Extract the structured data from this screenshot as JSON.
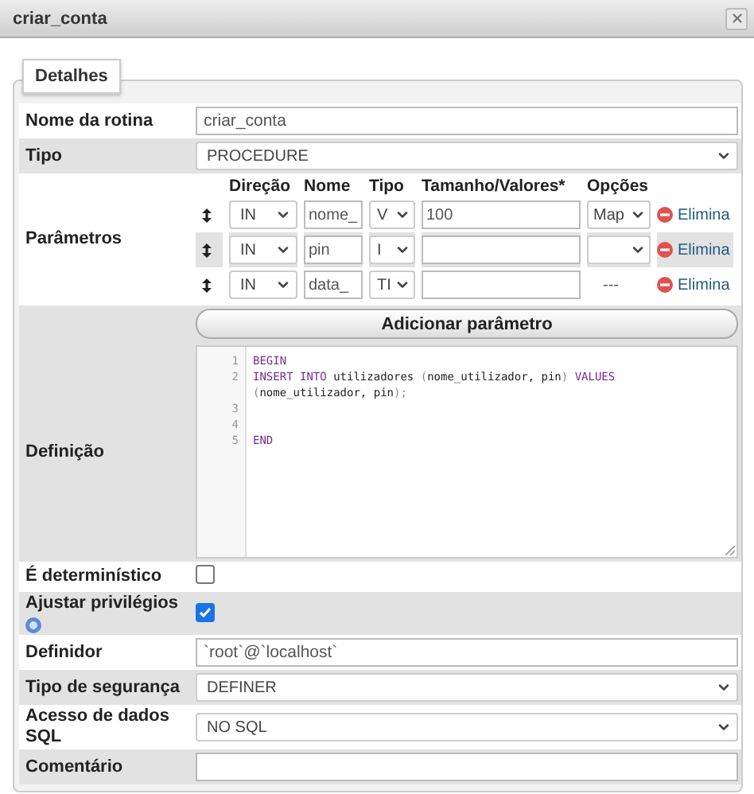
{
  "window": {
    "title": "criar_conta"
  },
  "tabs": [
    {
      "label": "Detalhes",
      "selected": true
    }
  ],
  "fields": [
    {
      "kind": "input",
      "label": "Nome da rotina",
      "value": "criar_conta"
    },
    {
      "kind": "select",
      "label": "Tipo",
      "value": "PROCEDURE"
    },
    {
      "kind": "params",
      "label": "Parâmetros",
      "columns": [
        "Direção",
        "Nome",
        "Tipo",
        "Tamanho/Valores*",
        "Opções"
      ],
      "rows": [
        {
          "direction": "IN",
          "name": "nome_",
          "type": "V",
          "size": "100",
          "options": {
            "kind": "select",
            "value": "Map"
          },
          "remove": "Elimina"
        },
        {
          "direction": "IN",
          "name": "pin",
          "type": "I",
          "size": "",
          "options": {
            "kind": "select"
          },
          "remove": "Elimina"
        },
        {
          "direction": "IN",
          "name": "data_",
          "type": "TI",
          "size": "",
          "options": {
            "kind": "text",
            "value": "---"
          },
          "remove": "Elimina"
        }
      ],
      "add_button": "Adicionar parâmetro"
    },
    {
      "kind": "code",
      "label": "Definição",
      "lines": [
        {
          "number": "1",
          "tokens": [
            {
              "text": "BEGIN",
              "kind": "keyword"
            }
          ]
        },
        {
          "number": "2",
          "tokens": [
            {
              "text": "INSERT INTO",
              "kind": "keyword"
            },
            {
              "text": " utilizadores ",
              "kind": "plain"
            },
            {
              "text": "(",
              "kind": "punct"
            },
            {
              "text": "nome_utilizador, pin",
              "kind": "plain"
            },
            {
              "text": ")",
              "kind": "punct"
            },
            {
              "text": " VALUES ",
              "kind": "keyword"
            },
            {
              "text": "(",
              "kind": "punct"
            },
            {
              "text": "nome_utilizador, pin",
              "kind": "plain"
            },
            {
              "text": ");",
              "kind": "punct"
            }
          ]
        },
        {
          "number": "3"
        },
        {
          "number": "4"
        },
        {
          "number": "5",
          "tokens": [
            {
              "text": "END",
              "kind": "keyword"
            }
          ]
        }
      ]
    },
    {
      "kind": "checkbox",
      "label": "É determinístico",
      "checked": false
    },
    {
      "kind": "checkbox",
      "label": "Ajustar privilégios",
      "checked": true,
      "help": true
    },
    {
      "kind": "input",
      "label": "Definidor",
      "value": "`root`@`localhost`"
    },
    {
      "kind": "select",
      "label": "Tipo de segurança",
      "value": "DEFINER"
    },
    {
      "kind": "select",
      "label": "Acesso de dados SQL",
      "value": "NO SQL"
    },
    {
      "kind": "input",
      "label": "Comentário"
    }
  ]
}
